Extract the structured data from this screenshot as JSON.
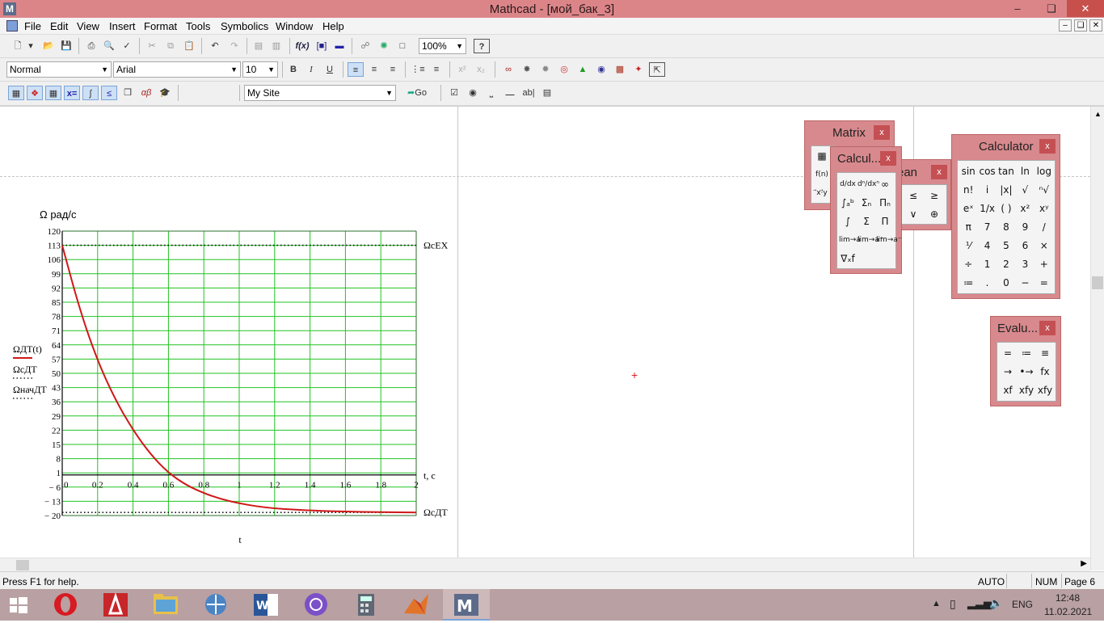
{
  "window": {
    "app_icon": "M",
    "title": "Mathcad - [мой_бак_3]"
  },
  "menu": [
    "File",
    "Edit",
    "View",
    "Insert",
    "Format",
    "Tools",
    "Symbolics",
    "Window",
    "Help"
  ],
  "toolbar": {
    "zoom": "100%",
    "style": "Normal",
    "font": "Arial",
    "size": "10",
    "site": "My Site",
    "go_label": "Go"
  },
  "graph": {
    "y_axis_label": "Ω рад/с",
    "x_axis_label": "t",
    "x_unit_label": "t, c",
    "legend": [
      {
        "label": "ΩДТ(t)",
        "style": "solid",
        "color": "#d01818"
      },
      {
        "label": "ΩcДТ",
        "style": "dotted",
        "color": "#222222"
      },
      {
        "label": "ΩначДТ",
        "style": "dotted",
        "color": "#222222"
      }
    ],
    "line_labels": {
      "top": "ΩcEX",
      "bottom": "ΩcДТ"
    }
  },
  "chart_data": {
    "type": "line",
    "x": [
      0,
      0.1,
      0.2,
      0.3,
      0.4,
      0.5,
      0.6,
      0.7,
      0.8,
      0.9,
      1.0,
      1.1,
      1.2,
      1.3,
      1.4,
      1.5,
      1.6,
      1.7,
      1.8,
      1.9,
      2.0
    ],
    "series": [
      {
        "name": "ΩДТ(t)",
        "values": [
          113,
          81,
          56,
          37,
          22,
          10,
          1,
          -5,
          -9,
          -12,
          -14,
          -15.5,
          -16.5,
          -17,
          -17.5,
          -17.8,
          -18,
          -18.2,
          -18.3,
          -18.4,
          -18.5
        ]
      },
      {
        "name": "ΩcEX",
        "values": [
          113,
          113,
          113,
          113,
          113,
          113,
          113,
          113,
          113,
          113,
          113,
          113,
          113,
          113,
          113,
          113,
          113,
          113,
          113,
          113,
          113
        ]
      },
      {
        "name": "ΩcДТ",
        "values": [
          -18.5,
          -18.5,
          -18.5,
          -18.5,
          -18.5,
          -18.5,
          -18.5,
          -18.5,
          -18.5,
          -18.5,
          -18.5,
          -18.5,
          -18.5,
          -18.5,
          -18.5,
          -18.5,
          -18.5,
          -18.5,
          -18.5,
          -18.5,
          -18.5
        ]
      }
    ],
    "x_ticks": [
      "0",
      "0.2",
      "0.4",
      "0.6",
      "0.8",
      "1",
      "1.2",
      "1.4",
      "1.6",
      "1.8",
      "2"
    ],
    "y_ticks": [
      "120",
      "113",
      "106",
      "99",
      "92",
      "85",
      "78",
      "71",
      "64",
      "57",
      "50",
      "43",
      "36",
      "29",
      "22",
      "15",
      "8",
      "1",
      "− 6",
      "− 13",
      "− 20"
    ],
    "y_tick_values": [
      120,
      113,
      106,
      99,
      92,
      85,
      78,
      71,
      64,
      57,
      50,
      43,
      36,
      29,
      22,
      15,
      8,
      1,
      -6,
      -13,
      -20
    ],
    "xlim": [
      0,
      2
    ],
    "ylim": [
      -20,
      120
    ],
    "grid": true,
    "grid_color": "#22c322",
    "curve_color": "#d01818"
  },
  "panels": {
    "matrix": {
      "title": "Matrix",
      "cells": [
        "▦",
        "f(n)",
        "⃗x·⃗y"
      ]
    },
    "calculus": {
      "title": "Calcul...",
      "cells": [
        "d/dx",
        "dⁿ/dxⁿ",
        "∞",
        "∫ₐᵇ",
        "Σₙ",
        "Πₙ",
        "∫",
        "Σ",
        "Π",
        "lim→a",
        "lim→a⁺",
        "lim→a⁻",
        "∇ₓf"
      ]
    },
    "boolean": {
      "title": "ean",
      "cells": [
        "≤",
        "≥",
        "∨",
        "⊕"
      ]
    },
    "calculator": {
      "title": "Calculator",
      "cells": [
        "sin",
        "cos",
        "tan",
        "ln",
        "log",
        "n!",
        "i",
        "|x|",
        "√",
        "ⁿ√",
        "eˣ",
        "1/x",
        "( )",
        "x²",
        "xʸ",
        "π",
        "7",
        "8",
        "9",
        "/",
        "⅟",
        "4",
        "5",
        "6",
        "×",
        "÷",
        "1",
        "2",
        "3",
        "+",
        "≔",
        ".",
        "0",
        "−",
        "="
      ]
    },
    "evaluation": {
      "title": "Evalu...",
      "cells": [
        "=",
        "≔",
        "≡",
        "→",
        "•→",
        "fx",
        "xf",
        "xfy",
        "xfy"
      ]
    },
    "close_label": "x"
  },
  "status": {
    "help": "Press F1 for help.",
    "auto": "AUTO",
    "num": "NUM",
    "page": "Page 6"
  },
  "taskbar": {
    "lang": "ENG",
    "time": "12:48",
    "date": "11.02.2021"
  }
}
